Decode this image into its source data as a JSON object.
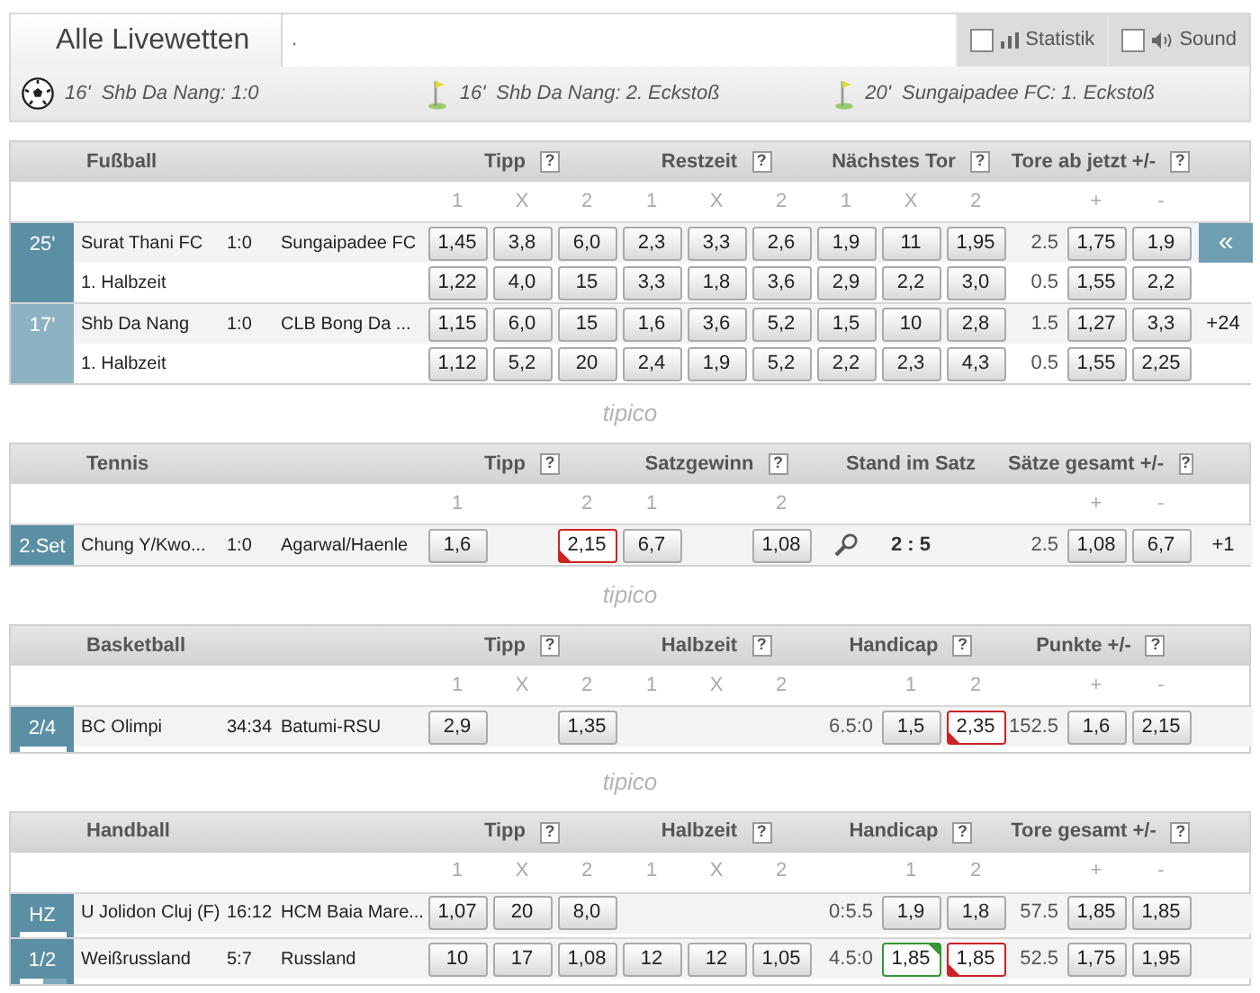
{
  "header": {
    "title": "Alle Livewetten",
    "field_value": ".",
    "toggles": [
      {
        "kind": "stats",
        "label": "Statistik",
        "checked": false
      },
      {
        "kind": "sound",
        "label": "Sound",
        "checked": false
      }
    ]
  },
  "ticker": [
    {
      "kind": "goal",
      "minute": "16'",
      "text": "Shb Da Nang: 1:0"
    },
    {
      "kind": "corner",
      "minute": "16'",
      "text": "Shb Da Nang: 2. Eckstoß"
    },
    {
      "kind": "corner",
      "minute": "20'",
      "text": "Sungaipadee FC: 1. Eckstoß"
    }
  ],
  "sections": [
    {
      "sport": "Fußball",
      "groups": [
        {
          "label": "Tipp",
          "help": "?"
        },
        {
          "label": "Restzeit",
          "help": "?"
        },
        {
          "label": "Nächstes Tor",
          "help": "?"
        },
        {
          "label": "Tore ab jetzt +/-",
          "help": "?"
        }
      ],
      "subheaders": [
        {
          "kind": "label",
          "label": "1"
        },
        {
          "kind": "label",
          "label": "X"
        },
        {
          "kind": "label",
          "label": "2"
        },
        {
          "kind": "label",
          "label": "1"
        },
        {
          "kind": "label",
          "label": "X"
        },
        {
          "kind": "label",
          "label": "2"
        },
        {
          "kind": "label",
          "label": "1"
        },
        {
          "kind": "label",
          "label": "X"
        },
        {
          "kind": "label",
          "label": "2"
        },
        {
          "kind": "blank"
        },
        {
          "kind": "label",
          "label": "+"
        },
        {
          "kind": "label",
          "label": "-"
        }
      ],
      "matches": [
        {
          "status": {
            "text": "25'",
            "selected": true
          },
          "lines": [
            {
              "home": "Surat Thani FC",
              "score": "1:0",
              "away": "Sungaipadee FC",
              "extra": {
                "kind": "button",
                "text": "«"
              },
              "cells": [
                {
                  "kind": "odd",
                  "value": "1,45"
                },
                {
                  "kind": "odd",
                  "value": "3,8"
                },
                {
                  "kind": "odd",
                  "value": "6,0"
                },
                {
                  "kind": "odd",
                  "value": "2,3"
                },
                {
                  "kind": "odd",
                  "value": "3,3"
                },
                {
                  "kind": "odd",
                  "value": "2,6"
                },
                {
                  "kind": "odd",
                  "value": "1,9"
                },
                {
                  "kind": "odd",
                  "value": "11"
                },
                {
                  "kind": "odd",
                  "value": "1,95"
                },
                {
                  "kind": "line",
                  "value": "2.5"
                },
                {
                  "kind": "odd",
                  "value": "1,75"
                },
                {
                  "kind": "odd",
                  "value": "1,9"
                }
              ]
            },
            {
              "home": "1. Halbzeit",
              "cells": [
                {
                  "kind": "odd",
                  "value": "1,22"
                },
                {
                  "kind": "odd",
                  "value": "4,0"
                },
                {
                  "kind": "odd",
                  "value": "15"
                },
                {
                  "kind": "odd",
                  "value": "3,3"
                },
                {
                  "kind": "odd",
                  "value": "1,8"
                },
                {
                  "kind": "odd",
                  "value": "3,6"
                },
                {
                  "kind": "odd",
                  "value": "2,9"
                },
                {
                  "kind": "odd",
                  "value": "2,2"
                },
                {
                  "kind": "odd",
                  "value": "3,0"
                },
                {
                  "kind": "line",
                  "value": "0.5"
                },
                {
                  "kind": "odd",
                  "value": "1,55"
                },
                {
                  "kind": "odd",
                  "value": "2,2"
                }
              ]
            }
          ]
        },
        {
          "status": {
            "text": "17'",
            "selected": false
          },
          "lines": [
            {
              "home": "Shb Da Nang",
              "score": "1:0",
              "away": "CLB Bong Da ...",
              "extra": {
                "kind": "text",
                "text": "+24"
              },
              "cells": [
                {
                  "kind": "odd",
                  "value": "1,15"
                },
                {
                  "kind": "odd",
                  "value": "6,0"
                },
                {
                  "kind": "odd",
                  "value": "15"
                },
                {
                  "kind": "odd",
                  "value": "1,6"
                },
                {
                  "kind": "odd",
                  "value": "3,6"
                },
                {
                  "kind": "odd",
                  "value": "5,2"
                },
                {
                  "kind": "odd",
                  "value": "1,5"
                },
                {
                  "kind": "odd",
                  "value": "10"
                },
                {
                  "kind": "odd",
                  "value": "2,8"
                },
                {
                  "kind": "line",
                  "value": "1.5"
                },
                {
                  "kind": "odd",
                  "value": "1,27"
                },
                {
                  "kind": "odd",
                  "value": "3,3"
                }
              ]
            },
            {
              "home": "1. Halbzeit",
              "cells": [
                {
                  "kind": "odd",
                  "value": "1,12"
                },
                {
                  "kind": "odd",
                  "value": "5,2"
                },
                {
                  "kind": "odd",
                  "value": "20"
                },
                {
                  "kind": "odd",
                  "value": "2,4"
                },
                {
                  "kind": "odd",
                  "value": "1,9"
                },
                {
                  "kind": "odd",
                  "value": "5,2"
                },
                {
                  "kind": "odd",
                  "value": "2,2"
                },
                {
                  "kind": "odd",
                  "value": "2,3"
                },
                {
                  "kind": "odd",
                  "value": "4,3"
                },
                {
                  "kind": "line",
                  "value": "0.5"
                },
                {
                  "kind": "odd",
                  "value": "1,55"
                },
                {
                  "kind": "odd",
                  "value": "2,25"
                }
              ]
            }
          ]
        }
      ]
    },
    {
      "sport": "Tennis",
      "divider": "tipico",
      "groups": [
        {
          "label": "Tipp",
          "help": "?"
        },
        {
          "label": "Satzgewinn",
          "help": "?"
        },
        {
          "label": "Stand im Satz"
        },
        {
          "label": "Sätze gesamt +/-",
          "help": "?"
        }
      ],
      "subheaders": [
        {
          "kind": "label",
          "label": "1"
        },
        {
          "kind": "blank"
        },
        {
          "kind": "label",
          "label": "2"
        },
        {
          "kind": "label",
          "label": "1"
        },
        {
          "kind": "blank"
        },
        {
          "kind": "label",
          "label": "2"
        },
        {
          "kind": "blank"
        },
        {
          "kind": "blank"
        },
        {
          "kind": "blank"
        },
        {
          "kind": "blank"
        },
        {
          "kind": "label",
          "label": "+"
        },
        {
          "kind": "label",
          "label": "-"
        }
      ],
      "matches": [
        {
          "status": {
            "text": "2.Set",
            "selected": true
          },
          "lines": [
            {
              "home": "Chung Y/Kwo...",
              "score": "1:0",
              "away": "Agarwal/Haenle",
              "extra": {
                "kind": "text",
                "text": "+1"
              },
              "cells": [
                {
                  "kind": "odd",
                  "value": "1,6"
                },
                {
                  "kind": "blank"
                },
                {
                  "kind": "odd_down",
                  "value": "2,15"
                },
                {
                  "kind": "odd",
                  "value": "6,7"
                },
                {
                  "kind": "blank"
                },
                {
                  "kind": "odd",
                  "value": "1,08"
                },
                {
                  "kind": "icon"
                },
                {
                  "kind": "score",
                  "value": "2 : 5"
                },
                {
                  "kind": "blank"
                },
                {
                  "kind": "line",
                  "value": "2.5"
                },
                {
                  "kind": "odd",
                  "value": "1,08"
                },
                {
                  "kind": "odd",
                  "value": "6,7"
                }
              ]
            }
          ]
        }
      ]
    },
    {
      "sport": "Basketball",
      "divider": "tipico",
      "groups": [
        {
          "label": "Tipp",
          "help": "?"
        },
        {
          "label": "Halbzeit",
          "help": "?"
        },
        {
          "label": "Handicap",
          "help": "?"
        },
        {
          "label": "Punkte +/-",
          "help": "?"
        }
      ],
      "subheaders": [
        {
          "kind": "label",
          "label": "1"
        },
        {
          "kind": "label",
          "label": "X"
        },
        {
          "kind": "label",
          "label": "2"
        },
        {
          "kind": "label",
          "label": "1"
        },
        {
          "kind": "label",
          "label": "X"
        },
        {
          "kind": "label",
          "label": "2"
        },
        {
          "kind": "blank"
        },
        {
          "kind": "label",
          "label": "1"
        },
        {
          "kind": "label",
          "label": "2"
        },
        {
          "kind": "blank"
        },
        {
          "kind": "label",
          "label": "+"
        },
        {
          "kind": "label",
          "label": "-"
        }
      ],
      "matches": [
        {
          "status": {
            "text": "2/4",
            "selected": true,
            "level": 1
          },
          "lines": [
            {
              "home": "BC Olimpi",
              "score": "34:34",
              "away": "Batumi-RSU",
              "cells": [
                {
                  "kind": "odd",
                  "value": "2,9"
                },
                {
                  "kind": "blank"
                },
                {
                  "kind": "odd",
                  "value": "1,35"
                },
                {
                  "kind": "blank"
                },
                {
                  "kind": "blank"
                },
                {
                  "kind": "blank"
                },
                {
                  "kind": "line",
                  "value": "6.5:0"
                },
                {
                  "kind": "odd",
                  "value": "1,5"
                },
                {
                  "kind": "odd_down",
                  "value": "2,35"
                },
                {
                  "kind": "line",
                  "value": "152.5"
                },
                {
                  "kind": "odd",
                  "value": "1,6"
                },
                {
                  "kind": "odd",
                  "value": "2,15"
                }
              ]
            }
          ]
        }
      ]
    },
    {
      "sport": "Handball",
      "divider": "tipico",
      "groups": [
        {
          "label": "Tipp",
          "help": "?"
        },
        {
          "label": "Halbzeit",
          "help": "?"
        },
        {
          "label": "Handicap",
          "help": "?"
        },
        {
          "label": "Tore gesamt +/-",
          "help": "?"
        }
      ],
      "subheaders": [
        {
          "kind": "label",
          "label": "1"
        },
        {
          "kind": "label",
          "label": "X"
        },
        {
          "kind": "label",
          "label": "2"
        },
        {
          "kind": "label",
          "label": "1"
        },
        {
          "kind": "label",
          "label": "X"
        },
        {
          "kind": "label",
          "label": "2"
        },
        {
          "kind": "blank"
        },
        {
          "kind": "label",
          "label": "1"
        },
        {
          "kind": "label",
          "label": "2"
        },
        {
          "kind": "blank"
        },
        {
          "kind": "label",
          "label": "+"
        },
        {
          "kind": "label",
          "label": "-"
        }
      ],
      "matches": [
        {
          "status": {
            "text": "HZ",
            "selected": true,
            "level": 1
          },
          "lines": [
            {
              "home": "U Jolidon Cluj (F)",
              "score": "16:12",
              "away": "HCM Baia Mare...",
              "cells": [
                {
                  "kind": "odd",
                  "value": "1,07"
                },
                {
                  "kind": "odd",
                  "value": "20"
                },
                {
                  "kind": "odd",
                  "value": "8,0"
                },
                {
                  "kind": "blank"
                },
                {
                  "kind": "blank"
                },
                {
                  "kind": "blank"
                },
                {
                  "kind": "line",
                  "value": "0:5.5"
                },
                {
                  "kind": "odd",
                  "value": "1,9"
                },
                {
                  "kind": "odd",
                  "value": "1,8"
                },
                {
                  "kind": "line",
                  "value": "57.5"
                },
                {
                  "kind": "odd",
                  "value": "1,85"
                },
                {
                  "kind": "odd",
                  "value": "1,85"
                }
              ]
            }
          ]
        },
        {
          "status": {
            "text": "1/2",
            "selected": true,
            "level": 0.5
          },
          "lines": [
            {
              "home": "Weißrussland",
              "score": "5:7",
              "away": "Russland",
              "cells": [
                {
                  "kind": "odd",
                  "value": "10"
                },
                {
                  "kind": "odd",
                  "value": "17"
                },
                {
                  "kind": "odd",
                  "value": "1,08"
                },
                {
                  "kind": "odd",
                  "value": "12"
                },
                {
                  "kind": "odd",
                  "value": "12"
                },
                {
                  "kind": "odd",
                  "value": "1,05"
                },
                {
                  "kind": "line",
                  "value": "4.5:0"
                },
                {
                  "kind": "odd_up",
                  "value": "1,85"
                },
                {
                  "kind": "odd_down",
                  "value": "1,85"
                },
                {
                  "kind": "line",
                  "value": "52.5"
                },
                {
                  "kind": "odd",
                  "value": "1,75"
                },
                {
                  "kind": "odd",
                  "value": "1,95"
                }
              ]
            }
          ]
        }
      ]
    }
  ]
}
